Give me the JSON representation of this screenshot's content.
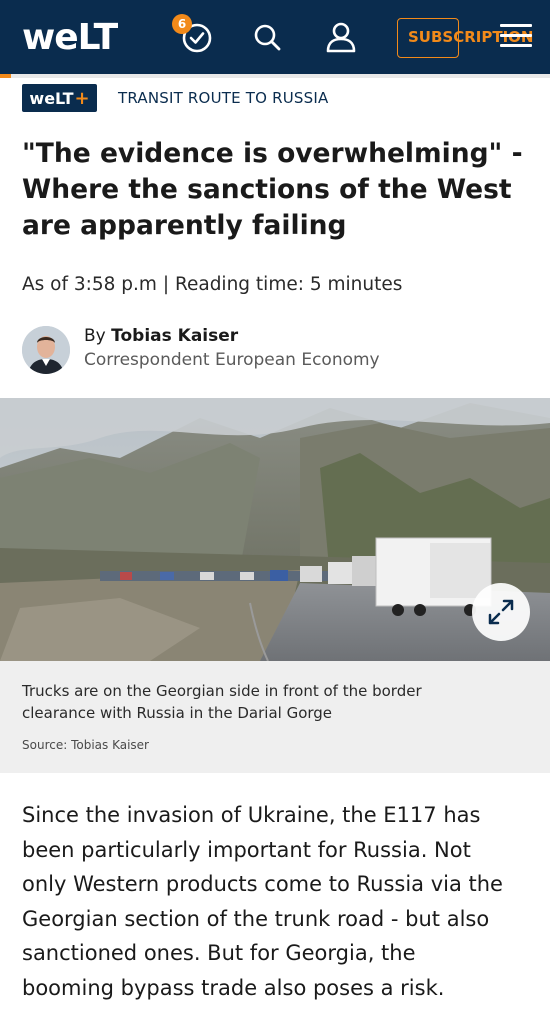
{
  "header": {
    "logo": "weLT",
    "notification_count": "6",
    "subscribe_label": "SUBSCRIPTION",
    "icons": [
      "check-clock-icon",
      "search-icon",
      "user-icon",
      "menu-icon"
    ]
  },
  "reading_progress": 0.02,
  "colors": {
    "navy": "#0a2c4e",
    "orange": "#f28a1a"
  },
  "kicker": {
    "badge_text": "weLT",
    "badge_plus": "+",
    "label": "TRANSIT ROUTE TO RUSSIA"
  },
  "article": {
    "headline_lines": [
      "\"The evidence is overwhelming\" -",
      "Where the sanctions of the West",
      "are apparently failing"
    ],
    "meta": "As of 3:58 p.m | Reading time: 5 minutes",
    "author_prefix": "By",
    "author_name": "Tobias Kaiser",
    "author_role": "Correspondent European Economy",
    "caption_lines": [
      "Trucks are on the Georgian side in front of the border",
      "clearance with Russia in the Darial Gorge"
    ],
    "source": "Source: Tobias Kaiser",
    "body_lines": [
      "Since the invasion of Ukraine, the E117 has",
      "been particularly important for Russia. Not",
      "only Western products come to Russia via the",
      "Georgian section of the trunk road - but also",
      "sanctioned ones. But for Georgia, the",
      "booming bypass trade also poses a risk."
    ]
  }
}
